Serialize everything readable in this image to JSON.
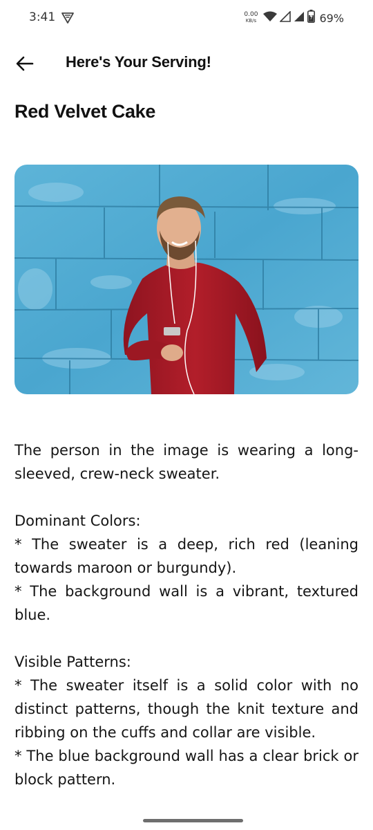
{
  "status_bar": {
    "time": "3:41",
    "net_speed_value": "0.00",
    "net_speed_unit": "KB/s",
    "battery_percent": "69%"
  },
  "app_bar": {
    "title": "Here's Your Serving!"
  },
  "item": {
    "title": "Red Velvet Cake",
    "image_icon": "photo-man-red-sweater-blue-wall"
  },
  "description": {
    "intro": "The person in the image is wearing a long-sleeved, crew-neck sweater.",
    "colors_heading": "Dominant Colors:",
    "colors_1": "* The sweater is a deep, rich red (leaning towards maroon or burgundy).",
    "colors_2": "* The background wall is a vibrant, textured blue.",
    "patterns_heading": "Visible Patterns:",
    "patterns_1": "* The sweater itself is a solid color with no distinct patterns, though the knit texture and ribbing on the cuffs and collar are visible.",
    "patterns_2": "* The blue background wall has a clear brick or block pattern."
  },
  "colors": {
    "wall_blue": "#4fa8cf",
    "sweater_red": "#a51a24"
  }
}
